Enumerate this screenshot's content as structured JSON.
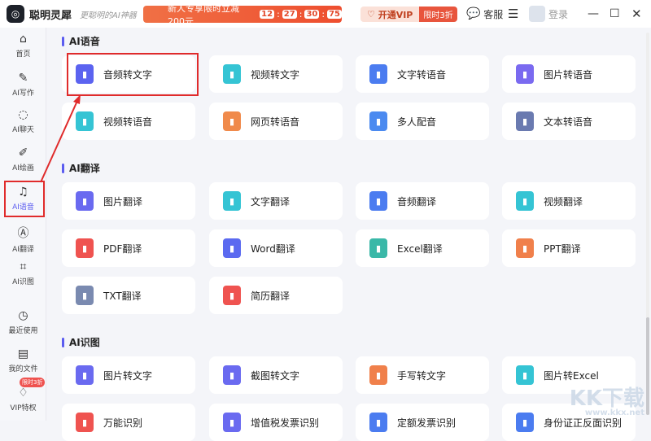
{
  "header": {
    "logo_icon": "app-logo-icon",
    "app_name": "聪明灵犀",
    "slogan": "更聪明的AI神器",
    "promo_text": "新人专享限时立减 200元",
    "countdown": [
      "12",
      "27",
      "30",
      "75"
    ],
    "vip_label": "开通VIP",
    "vip_badge": "限时3折",
    "service_label": "客服",
    "login_label": "登录"
  },
  "sidebar": {
    "items": [
      {
        "label": "首页",
        "icon": "home-icon"
      },
      {
        "label": "AI写作",
        "icon": "pen-icon"
      },
      {
        "label": "AI聊天",
        "icon": "chat-icon"
      },
      {
        "label": "AI绘画",
        "icon": "brush-icon"
      },
      {
        "label": "AI语音",
        "icon": "headphone-icon"
      },
      {
        "label": "AI翻译",
        "icon": "translate-icon"
      },
      {
        "label": "AI识图",
        "icon": "scan-icon"
      },
      {
        "label": "最近使用",
        "icon": "clock-icon"
      },
      {
        "label": "我的文件",
        "icon": "file-icon"
      },
      {
        "label": "VIP特权",
        "icon": "diamond-icon"
      }
    ],
    "vip_badge": "限时3折"
  },
  "sections": [
    {
      "title": "AI语音",
      "items": [
        {
          "label": "音频转文字",
          "color": "#5b63f0"
        },
        {
          "label": "视频转文字",
          "color": "#35c4d4"
        },
        {
          "label": "文字转语音",
          "color": "#4b7cf0"
        },
        {
          "label": "图片转语音",
          "color": "#7a6af0"
        },
        {
          "label": "视频转语音",
          "color": "#35c4d4"
        },
        {
          "label": "网页转语音",
          "color": "#f08a4b"
        },
        {
          "label": "多人配音",
          "color": "#4b8af0"
        },
        {
          "label": "文本转语音",
          "color": "#6a7ab0"
        }
      ]
    },
    {
      "title": "AI翻译",
      "items": [
        {
          "label": "图片翻译",
          "color": "#6a6af0"
        },
        {
          "label": "文字翻译",
          "color": "#35c4d4"
        },
        {
          "label": "音频翻译",
          "color": "#4b7cf0"
        },
        {
          "label": "视频翻译",
          "color": "#35c4d4"
        },
        {
          "label": "PDF翻译",
          "color": "#ef5350"
        },
        {
          "label": "Word翻译",
          "color": "#5b6af0"
        },
        {
          "label": "Excel翻译",
          "color": "#3ab8a8"
        },
        {
          "label": "PPT翻译",
          "color": "#f0804b"
        },
        {
          "label": "TXT翻译",
          "color": "#7a8ab0"
        },
        {
          "label": "简历翻译",
          "color": "#ef5350"
        }
      ]
    },
    {
      "title": "AI识图",
      "items": [
        {
          "label": "图片转文字",
          "color": "#6a6af0"
        },
        {
          "label": "截图转文字",
          "color": "#6a6af0"
        },
        {
          "label": "手写转文字",
          "color": "#f0804b"
        },
        {
          "label": "图片转Excel",
          "color": "#35c4d4"
        },
        {
          "label": "万能识别",
          "color": "#ef5350"
        },
        {
          "label": "增值税发票识别",
          "color": "#6a6af0"
        },
        {
          "label": "定额发票识别",
          "color": "#4b7cf0"
        },
        {
          "label": "身份证正反面识别",
          "color": "#4b7cf0"
        }
      ]
    }
  ],
  "watermark": {
    "text": "KK下载",
    "url": "www.kkx.net"
  }
}
